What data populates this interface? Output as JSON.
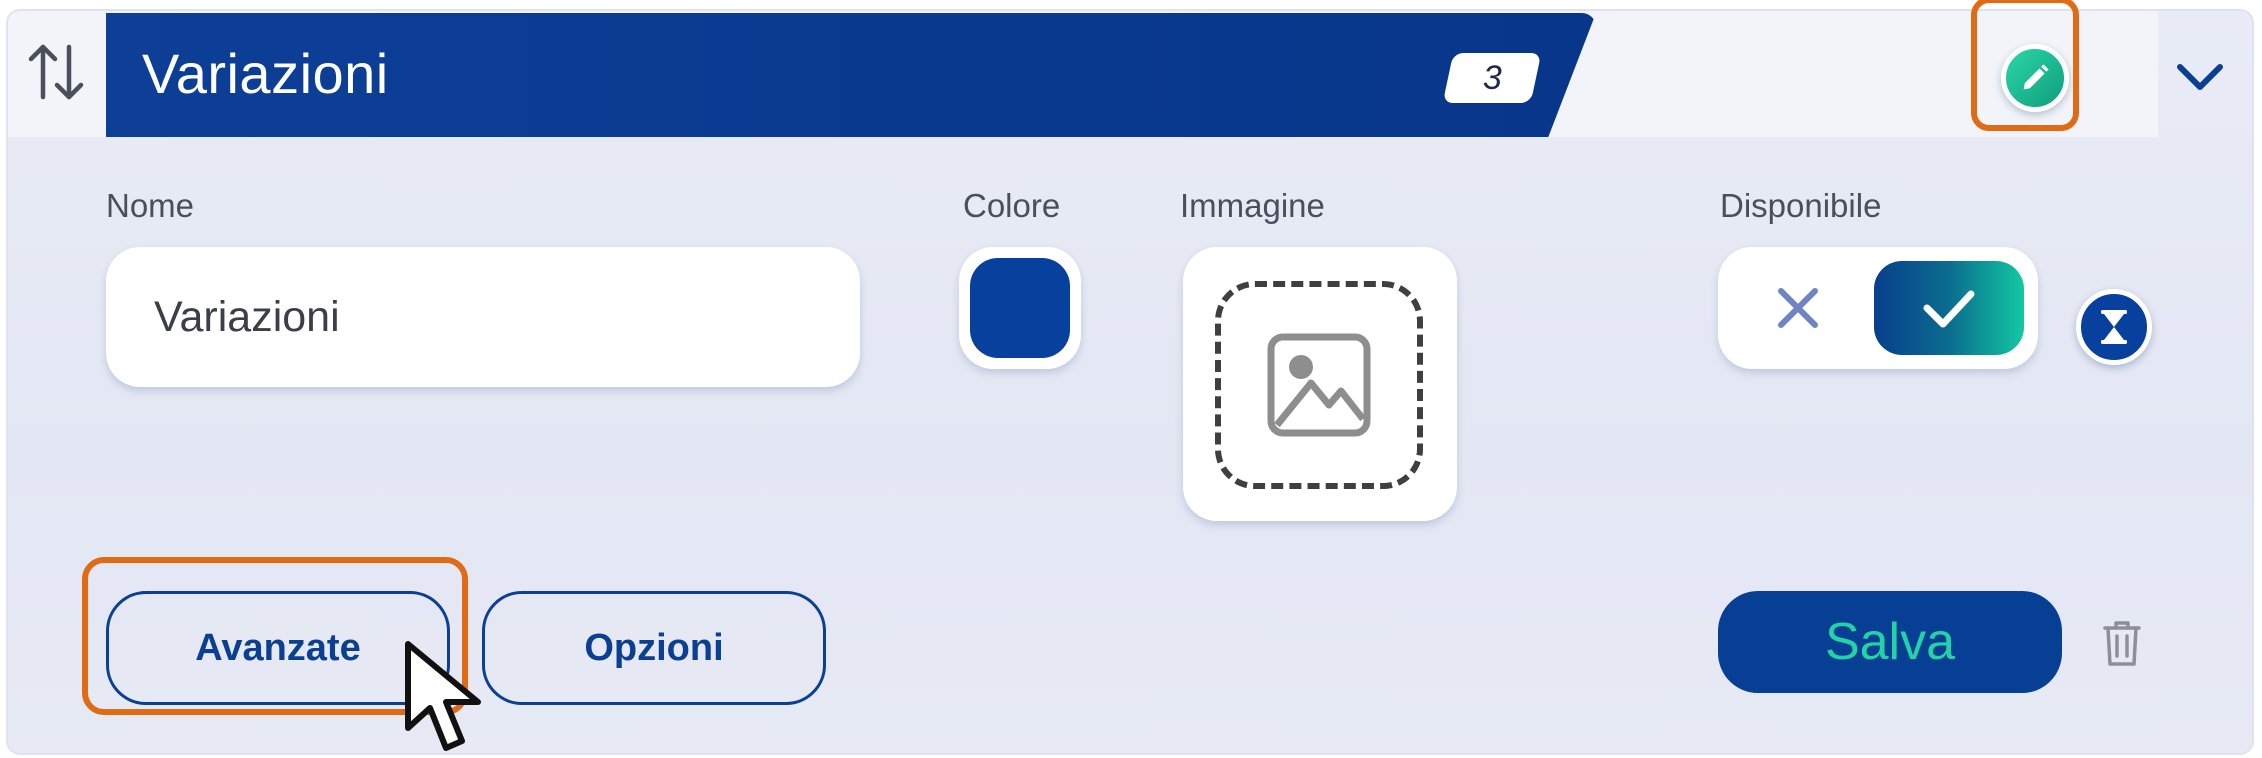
{
  "header": {
    "title": "Variazioni",
    "count": "3",
    "sort_icon": "sort-arrows-icon",
    "edit_icon": "pencil-icon",
    "collapse_icon": "chevron-down-icon"
  },
  "form": {
    "name_label": "Nome",
    "name_value": "Variazioni",
    "color_label": "Colore",
    "color_value": "#07409d",
    "image_label": "Immagine",
    "image_icon": "image-placeholder-icon",
    "available_label": "Disponibile",
    "available_state": "yes",
    "schedule_icon": "hourglass-icon"
  },
  "actions": {
    "advanced_label": "Avanzate",
    "options_label": "Opzioni",
    "save_label": "Salva",
    "delete_icon": "trash-icon"
  },
  "colors": {
    "primary": "#07409d",
    "accent": "#22d3a6",
    "highlight": "#e06b14"
  }
}
